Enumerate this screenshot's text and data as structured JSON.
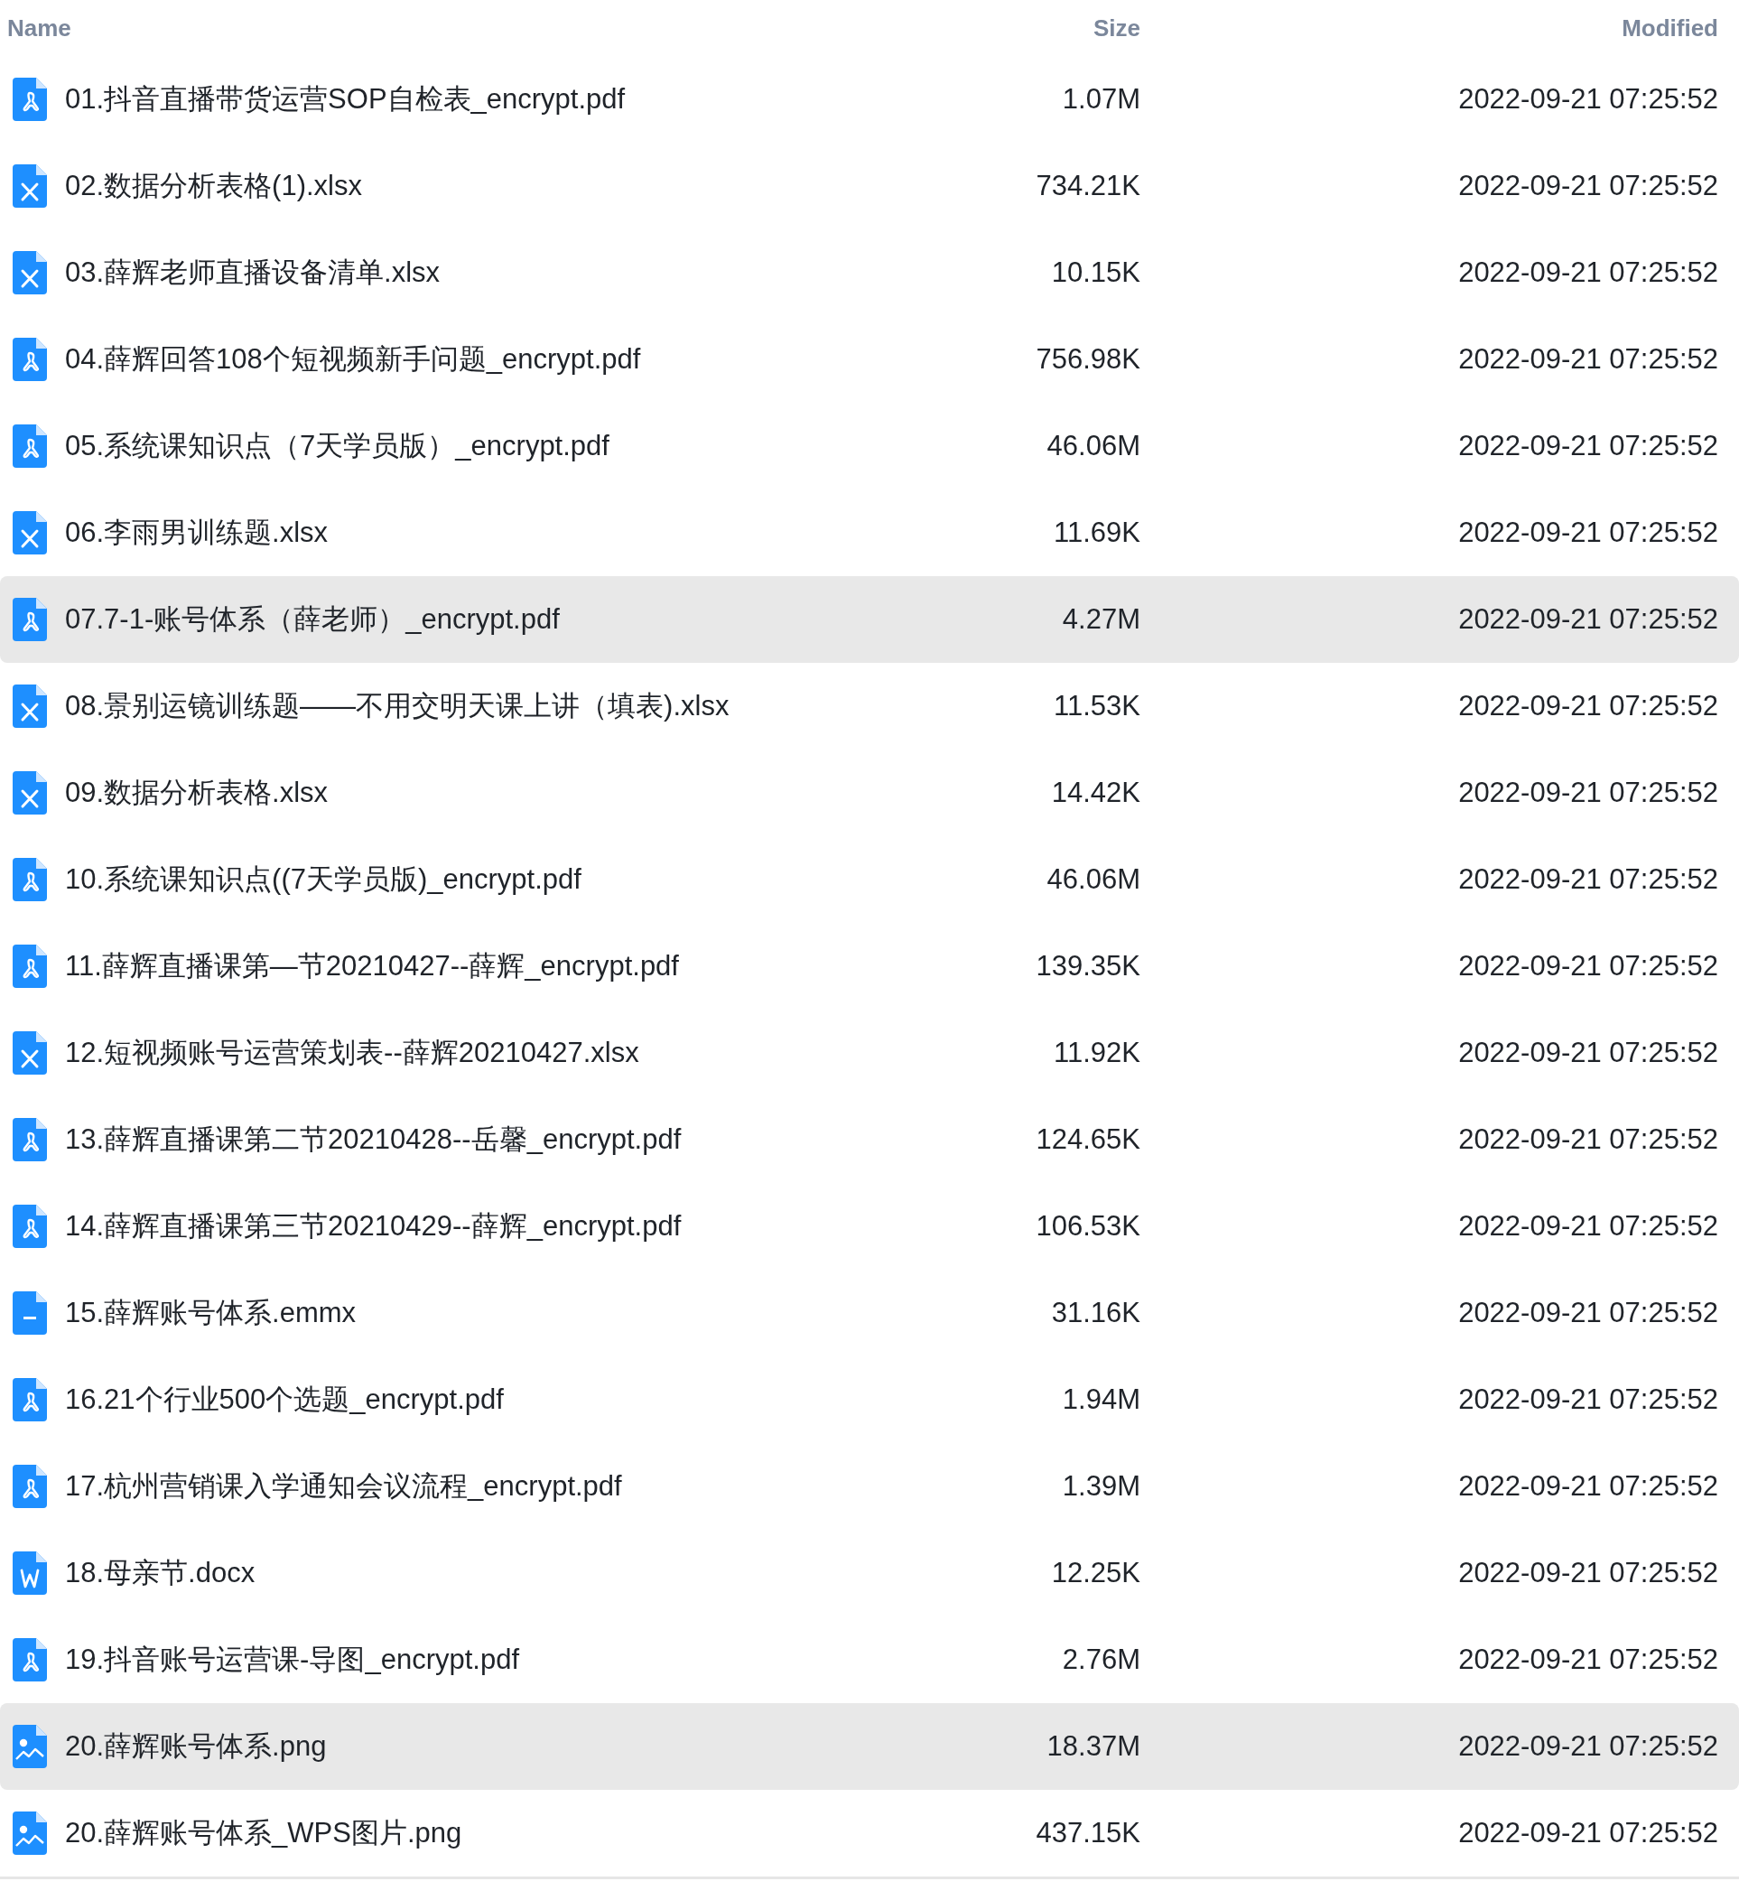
{
  "columns": [
    "Name",
    "Size",
    "Modified"
  ],
  "files": [
    {
      "kind": "pdf",
      "name": "01.抖音直播带货运营SOP自检表_encrypt.pdf",
      "size": "1.07M",
      "modified": "2022-09-21 07:25:52",
      "highlighted": false
    },
    {
      "kind": "xlsx",
      "name": "02.数据分析表格(1).xlsx",
      "size": "734.21K",
      "modified": "2022-09-21 07:25:52",
      "highlighted": false
    },
    {
      "kind": "xlsx",
      "name": "03.薛辉老师直播设备清单.xlsx",
      "size": "10.15K",
      "modified": "2022-09-21 07:25:52",
      "highlighted": false
    },
    {
      "kind": "pdf",
      "name": "04.薛辉回答108个短视频新手问题_encrypt.pdf",
      "size": "756.98K",
      "modified": "2022-09-21 07:25:52",
      "highlighted": false
    },
    {
      "kind": "pdf",
      "name": "05.系统课知识点（7天学员版）_encrypt.pdf",
      "size": "46.06M",
      "modified": "2022-09-21 07:25:52",
      "highlighted": false
    },
    {
      "kind": "xlsx",
      "name": "06.李雨男训练题.xlsx",
      "size": "11.69K",
      "modified": "2022-09-21 07:25:52",
      "highlighted": false
    },
    {
      "kind": "pdf",
      "name": "07.7-1-账号体系（薛老师）_encrypt.pdf",
      "size": "4.27M",
      "modified": "2022-09-21 07:25:52",
      "highlighted": true
    },
    {
      "kind": "xlsx",
      "name": "08.景别运镜训练题——不用交明天课上讲（填表).xlsx",
      "size": "11.53K",
      "modified": "2022-09-21 07:25:52",
      "highlighted": false
    },
    {
      "kind": "xlsx",
      "name": "09.数据分析表格.xlsx",
      "size": "14.42K",
      "modified": "2022-09-21 07:25:52",
      "highlighted": false
    },
    {
      "kind": "pdf",
      "name": "10.系统课知识点((7天学员版)_encrypt.pdf",
      "size": "46.06M",
      "modified": "2022-09-21 07:25:52",
      "highlighted": false
    },
    {
      "kind": "pdf",
      "name": "11.薛辉直播课第—节20210427--薛辉_encrypt.pdf",
      "size": "139.35K",
      "modified": "2022-09-21 07:25:52",
      "highlighted": false
    },
    {
      "kind": "xlsx",
      "name": "12.短视频账号运营策划表--薛辉20210427.xlsx",
      "size": "11.92K",
      "modified": "2022-09-21 07:25:52",
      "highlighted": false
    },
    {
      "kind": "pdf",
      "name": "13.薛辉直播课第二节20210428--岳馨_encrypt.pdf",
      "size": "124.65K",
      "modified": "2022-09-21 07:25:52",
      "highlighted": false
    },
    {
      "kind": "pdf",
      "name": "14.薛辉直播课第三节20210429--薛辉_encrypt.pdf",
      "size": "106.53K",
      "modified": "2022-09-21 07:25:52",
      "highlighted": false
    },
    {
      "kind": "emmx",
      "name": "15.薛辉账号体系.emmx",
      "size": "31.16K",
      "modified": "2022-09-21 07:25:52",
      "highlighted": false
    },
    {
      "kind": "pdf",
      "name": "16.21个行业500个选题_encrypt.pdf",
      "size": "1.94M",
      "modified": "2022-09-21 07:25:52",
      "highlighted": false
    },
    {
      "kind": "pdf",
      "name": "17.杭州营销课入学通知会议流程_encrypt.pdf",
      "size": "1.39M",
      "modified": "2022-09-21 07:25:52",
      "highlighted": false
    },
    {
      "kind": "docx",
      "name": "18.母亲节.docx",
      "size": "12.25K",
      "modified": "2022-09-21 07:25:52",
      "highlighted": false
    },
    {
      "kind": "pdf",
      "name": "19.抖音账号运营课-导图_encrypt.pdf",
      "size": "2.76M",
      "modified": "2022-09-21 07:25:52",
      "highlighted": false
    },
    {
      "kind": "png",
      "name": "20.薛辉账号体系.png",
      "size": "18.37M",
      "modified": "2022-09-21 07:25:52",
      "highlighted": true
    },
    {
      "kind": "png",
      "name": "20.薛辉账号体系_WPS图片.png",
      "size": "437.15K",
      "modified": "2022-09-21 07:25:52",
      "highlighted": false
    }
  ]
}
